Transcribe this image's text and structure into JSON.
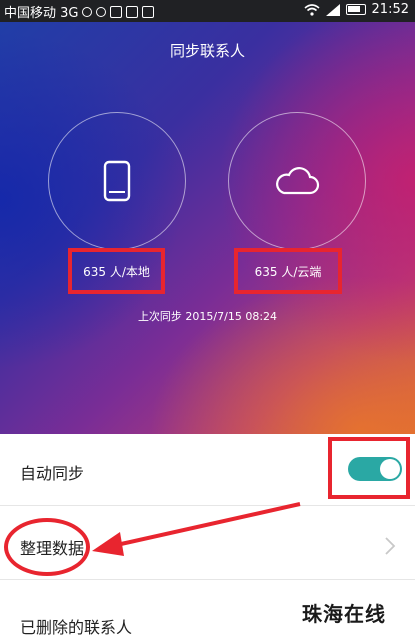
{
  "status_bar": {
    "carrier": "中国移动 3G",
    "time": "21:52"
  },
  "header": {
    "title": "同步联系人"
  },
  "local": {
    "count": "635 人/本地",
    "icon": "phone-icon"
  },
  "cloud": {
    "count": "635 人/云端",
    "icon": "cloud-icon"
  },
  "last_sync": "上次同步 2015/7/15 08:24",
  "settings": {
    "auto_sync": {
      "label": "自动同步",
      "enabled": true
    },
    "tidy_data": {
      "label": "整理数据"
    },
    "deleted_contacts": {
      "label": "已删除的联系人"
    }
  },
  "watermark": "珠海在线",
  "colors": {
    "annotation_red": "#e8252f",
    "toggle_on": "#2aa8a4"
  }
}
